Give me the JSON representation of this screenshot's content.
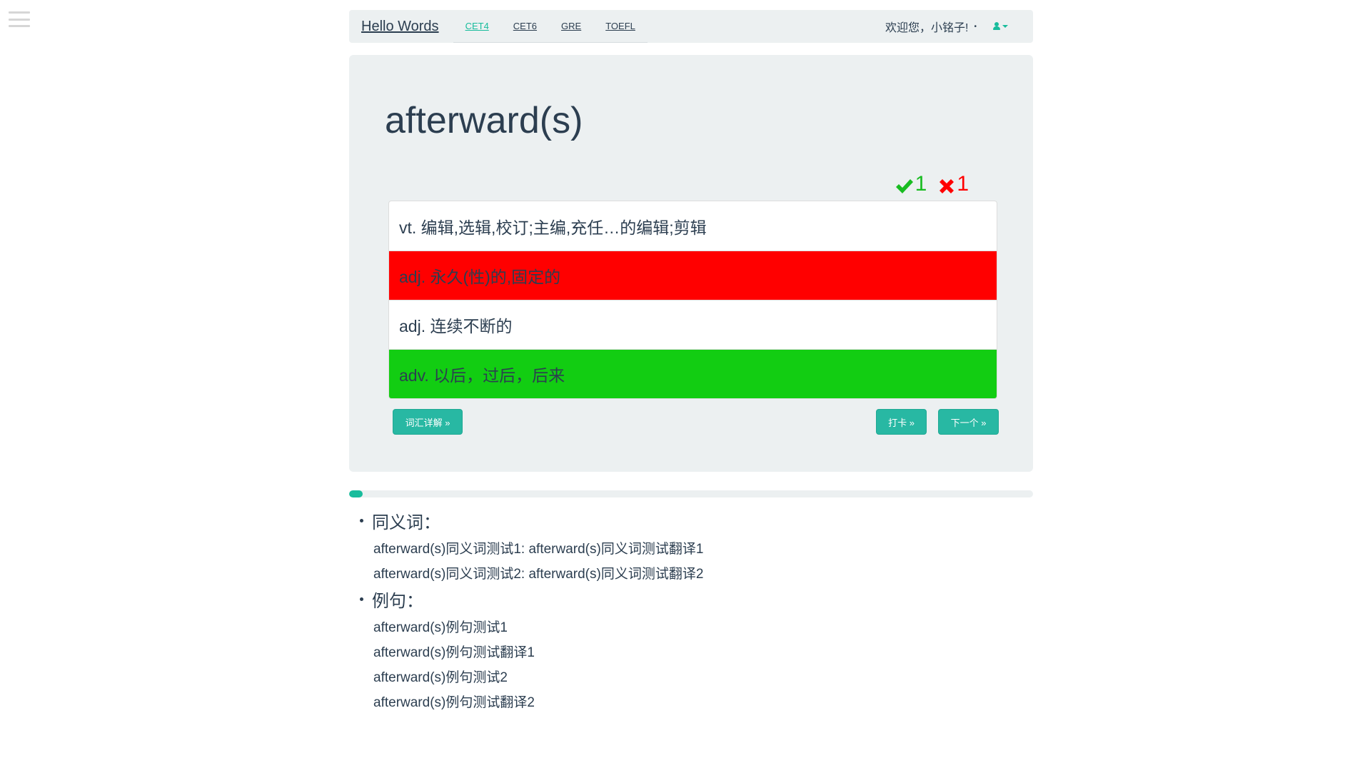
{
  "navbar": {
    "brand": "Hello Words",
    "links": [
      "CET4",
      "CET6",
      "GRE",
      "TOEFL"
    ],
    "active_link": "CET4",
    "welcome": "欢迎您，小铭子!",
    "dot": "•"
  },
  "card": {
    "word": "afterward(s)",
    "correct_count": "1",
    "wrong_count": "1",
    "options": [
      {
        "text": "vt. 编辑,选辑,校订;主编,充任…的编辑;剪辑",
        "state": "default"
      },
      {
        "text": "adj. 永久(性)的,固定的",
        "state": "wrong"
      },
      {
        "text": "adj. 连续不断的",
        "state": "default"
      },
      {
        "text": "adv. 以后，过后，后来",
        "state": "right"
      }
    ],
    "detail_button": "词汇详解 »",
    "checkin_button": "打卡 »",
    "next_button": "下一个 »"
  },
  "progress": {
    "value_percent": 2
  },
  "details": {
    "synonyms_title": "同义词：",
    "synonyms": [
      "afterward(s)同义词测试1: afterward(s)同义词测试翻译1",
      "afterward(s)同义词测试2: afterward(s)同义词测试翻译2"
    ],
    "examples_title": "例句：",
    "examples": [
      "afterward(s)例句测试1",
      "afterward(s)例句测试翻译1",
      "afterward(s)例句测试2",
      "afterward(s)例句测试翻译2"
    ]
  },
  "colors": {
    "accent": "#18bc9c",
    "wrong": "#ff0000",
    "right": "#12cd12",
    "panel": "#ecf0f1",
    "text": "#2c3e50"
  },
  "icons": {
    "menu": "hamburger-icon",
    "user": "user-icon",
    "dropdown": "caret-down-icon",
    "correct": "check-icon",
    "wrong": "cross-icon"
  }
}
